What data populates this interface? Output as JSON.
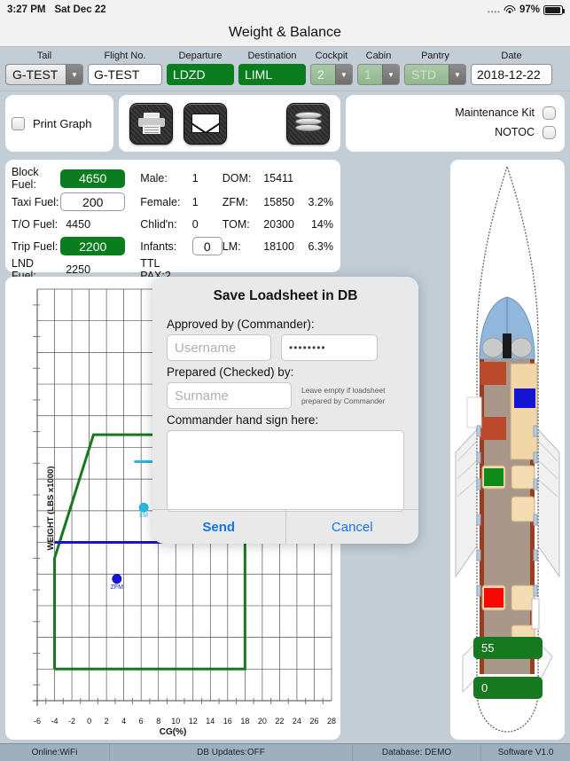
{
  "status_bar": {
    "time": "3:27 PM",
    "date": "Sat Dec 22",
    "battery": "97%",
    "wifi_icon": "wifi-icon",
    "battery_icon": "battery-icon"
  },
  "header": {
    "title": "Weight & Balance"
  },
  "form": {
    "tail": {
      "label": "Tail",
      "value": "G-TEST"
    },
    "flight_no": {
      "label": "Flight No.",
      "value": "G-TEST"
    },
    "departure": {
      "label": "Departure",
      "value": "LDZD"
    },
    "destination": {
      "label": "Destination",
      "value": "LIML"
    },
    "cockpit": {
      "label": "Cockpit",
      "value": "2"
    },
    "cabin": {
      "label": "Cabin",
      "value": "1"
    },
    "pantry": {
      "label": "Pantry",
      "value": "STD"
    },
    "date": {
      "label": "Date",
      "value": "2018-12-22"
    }
  },
  "toolbar": {
    "print_graph_label": "Print Graph",
    "print_icon": "printer-icon",
    "email_icon": "envelope-icon",
    "database_icon": "database-icon"
  },
  "options": {
    "maintenance_kit": "Maintenance Kit",
    "notoc": "NOTOC"
  },
  "data_panel": {
    "rows": [
      {
        "label": "Block Fuel:",
        "value": "4650",
        "style": "green",
        "pax_label": "Male:",
        "pax_value": "1",
        "w_label": "DOM:",
        "w_value": "15411",
        "pct": ""
      },
      {
        "label": "Taxi Fuel:",
        "value": "200",
        "style": "input",
        "pax_label": "Female:",
        "pax_value": "1",
        "w_label": "ZFM:",
        "w_value": "15850",
        "pct": "3.2%"
      },
      {
        "label": "T/O Fuel:",
        "value": "4450",
        "style": "plain",
        "pax_label": "Chlid'n:",
        "pax_value": "0",
        "w_label": "TOM:",
        "w_value": "20300",
        "pct": "14%"
      },
      {
        "label": "Trip Fuel:",
        "value": "2200",
        "style": "green",
        "pax_label": "Infants:",
        "pax_value": "0",
        "pax_style": "input",
        "w_label": "LM:",
        "w_value": "18100",
        "pct": "6.3%"
      },
      {
        "label": "LND Fuel:",
        "value": "2250",
        "style": "plain",
        "pax_label": "TTL PAX:2",
        "pax_value": "",
        "w_label": "",
        "w_value": "",
        "pct": ""
      }
    ]
  },
  "chart_data": {
    "type": "scatter",
    "title": "",
    "xlabel": "CG(%)",
    "ylabel": "WEIGHT (LBS x1000)",
    "xlim": [
      -6,
      28
    ],
    "ylim": [
      12,
      25
    ],
    "xticks": [
      -6,
      -4,
      -2,
      0,
      2,
      4,
      6,
      8,
      10,
      12,
      14,
      16,
      18,
      20,
      22,
      24,
      26,
      28
    ],
    "yticks": [
      12,
      13,
      14,
      15,
      16,
      17,
      18,
      19,
      20,
      21,
      22,
      23,
      24,
      25
    ],
    "grid": true,
    "legend": "none",
    "envelope": {
      "name": "CG envelope",
      "color": "#17791f",
      "points": [
        [
          -4,
          13
        ],
        [
          -4,
          16.5
        ],
        [
          0.5,
          20.4
        ],
        [
          12.6,
          20.4
        ],
        [
          18,
          17.2
        ],
        [
          18,
          16
        ],
        [
          18,
          13
        ],
        [
          -4,
          13
        ]
      ]
    },
    "limit_lines": [
      {
        "name": "ZFM limit",
        "color": "#1414d2",
        "y": 17.0,
        "x_from": -4,
        "x_to": 18
      },
      {
        "name": "LM limit",
        "color": "#2cb7e0",
        "y": 19.55,
        "x_from": 5.2,
        "x_to": 8.6
      }
    ],
    "points": [
      {
        "label": "ZFM",
        "x": 3.2,
        "y": 15.85,
        "color": "#1414d2"
      },
      {
        "label": "LM",
        "x": 6.3,
        "y": 18.1,
        "color": "#2cb7e0"
      }
    ]
  },
  "modal": {
    "title": "Save Loadsheet in DB",
    "approved_label": "Approved by (Commander):",
    "username_placeholder": "Username",
    "password_value": "••••••••",
    "prepared_label": "Prepared (Checked) by:",
    "surname_placeholder": "Surname",
    "hint": "Leave empty if loadsheet prepared by Commander",
    "sign_label": "Commander hand sign here:",
    "send_label": "Send",
    "cancel_label": "Cancel"
  },
  "aircraft": {
    "cargo_aft_value": "55",
    "cargo_fwd_value": "0"
  },
  "bottom_bar": {
    "online": "Online:WiFi",
    "db_updates": "DB Updates:OFF",
    "database": "Database: DEMO",
    "software": "Software V1.0"
  },
  "colors": {
    "accent_green": "#0a7d1e",
    "envelope_green": "#17791f",
    "blue_limit": "#1414d2",
    "cyan_limit": "#2cb7e0",
    "link_blue": "#1277e8",
    "page_bg": "#c3cdd6",
    "bottom_bar": "#9fb0bd"
  }
}
